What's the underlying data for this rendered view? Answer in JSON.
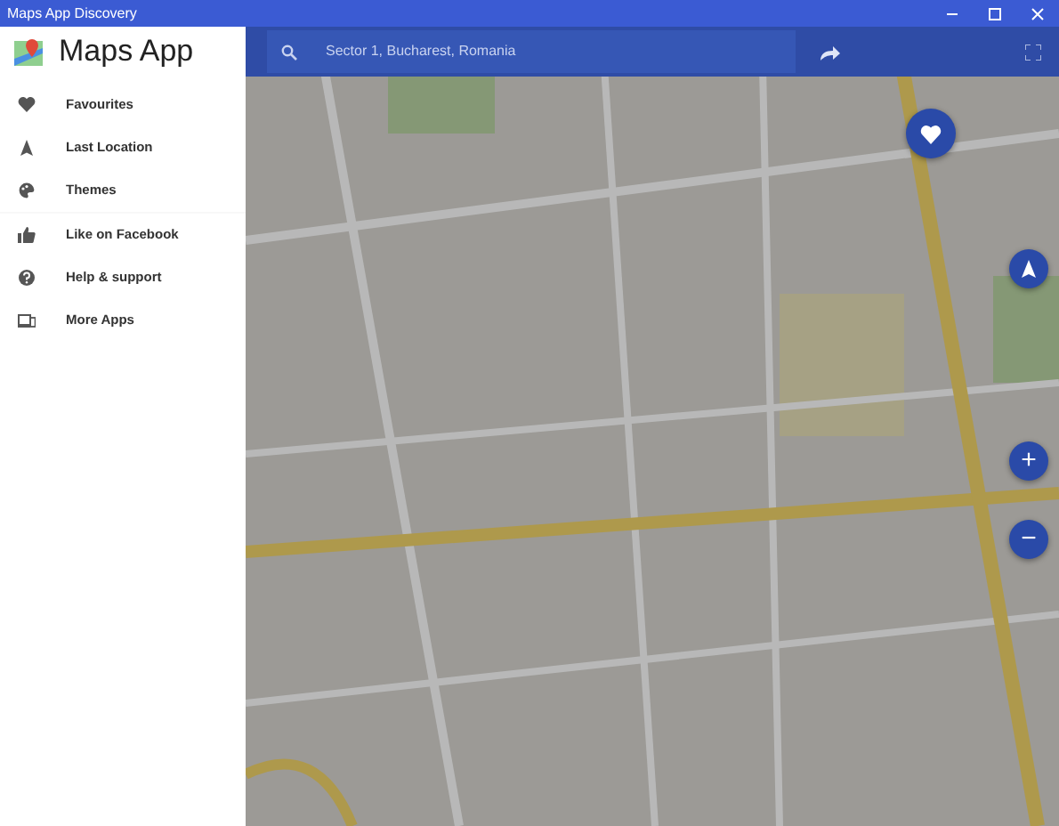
{
  "window": {
    "title": "Maps App Discovery"
  },
  "sidebar": {
    "title": "Maps App",
    "groups": [
      [
        {
          "kind": "heart",
          "label": "Favourites"
        },
        {
          "kind": "arrow",
          "label": "Last Location"
        },
        {
          "kind": "palette",
          "label": "Themes"
        }
      ],
      [
        {
          "kind": "thumb",
          "label": "Like on Facebook"
        },
        {
          "kind": "help",
          "label": "Help & support"
        },
        {
          "kind": "devices",
          "label": "More Apps"
        }
      ]
    ]
  },
  "search": {
    "value": "Sector 1, Bucharest, Romania"
  },
  "map": {
    "zoom_in": "+",
    "zoom_out": "−"
  }
}
